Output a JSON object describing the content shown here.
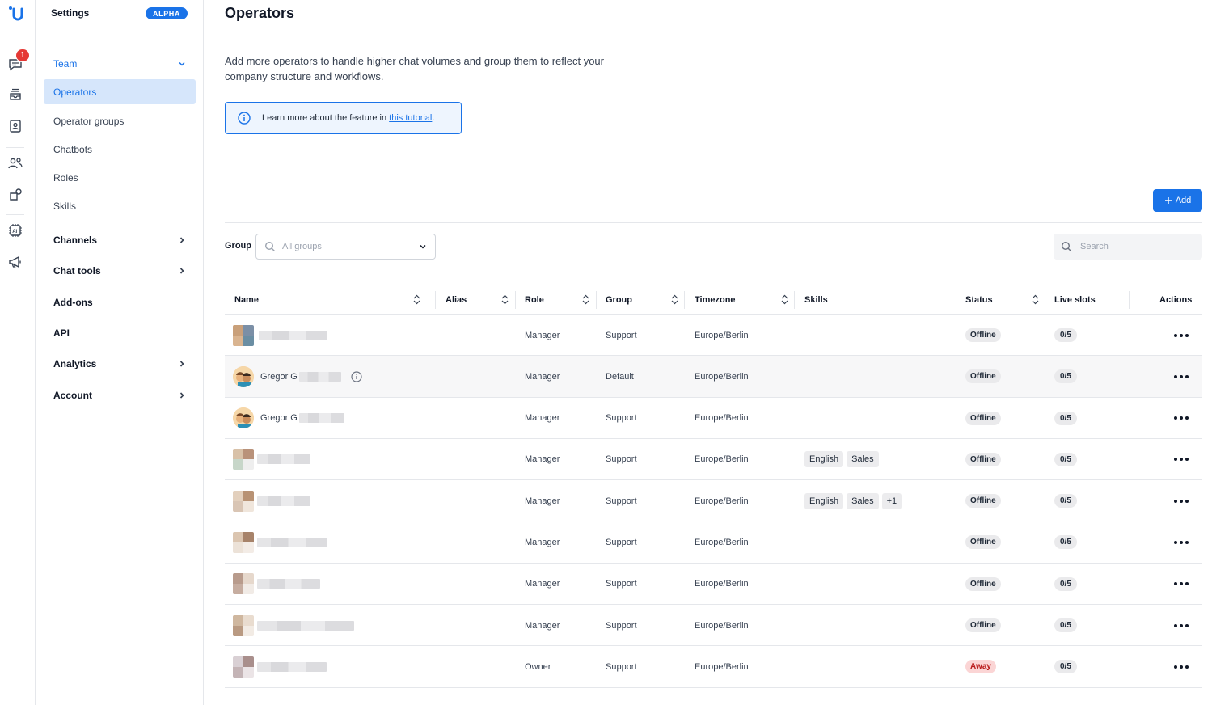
{
  "rail": {
    "chat_badge": "1",
    "icons": [
      "logo-icon",
      "chat-icon",
      "inbox-icon",
      "contacts-icon",
      "team-icon",
      "integrations-icon",
      "ai-icon",
      "campaigns-icon"
    ]
  },
  "sidebar": {
    "title": "Settings",
    "badge": "ALPHA",
    "team": "Team",
    "team_items": [
      "Operators",
      "Operator groups",
      "Chatbots",
      "Roles",
      "Skills"
    ],
    "sections": [
      "Channels",
      "Chat tools",
      "Add-ons",
      "API",
      "Analytics",
      "Account"
    ]
  },
  "main": {
    "title": "Operators",
    "description": "Add more operators to handle higher chat volumes and group them to reflect your company structure and workflows.",
    "info_text": "Learn more about the feature in ",
    "info_link": "this tutorial",
    "info_after": ".",
    "add_button": "Add",
    "group_label": "Group",
    "group_placeholder": "All groups",
    "search_placeholder": "Search"
  },
  "table": {
    "columns": [
      "Name",
      "Alias",
      "Role",
      "Group",
      "Timezone",
      "Skills",
      "Status",
      "Live slots",
      "Actions"
    ],
    "rows": [
      {
        "name": "",
        "role": "Manager",
        "group": "Support",
        "timezone": "Europe/Berlin",
        "skills": [],
        "status": "Offline",
        "slots": "0/5"
      },
      {
        "name": "Gregor G",
        "role": "Manager",
        "group": "Default",
        "timezone": "Europe/Berlin",
        "skills": [],
        "status": "Offline",
        "slots": "0/5"
      },
      {
        "name": "Gregor G",
        "role": "Manager",
        "group": "Support",
        "timezone": "Europe/Berlin",
        "skills": [],
        "status": "Offline",
        "slots": "0/5"
      },
      {
        "name": "",
        "role": "Manager",
        "group": "Support",
        "timezone": "Europe/Berlin",
        "skills": [
          "English",
          "Sales"
        ],
        "status": "Offline",
        "slots": "0/5"
      },
      {
        "name": "",
        "role": "Manager",
        "group": "Support",
        "timezone": "Europe/Berlin",
        "skills": [
          "English",
          "Sales",
          "+1"
        ],
        "status": "Offline",
        "slots": "0/5"
      },
      {
        "name": "",
        "role": "Manager",
        "group": "Support",
        "timezone": "Europe/Berlin",
        "skills": [],
        "status": "Offline",
        "slots": "0/5"
      },
      {
        "name": "",
        "role": "Manager",
        "group": "Support",
        "timezone": "Europe/Berlin",
        "skills": [],
        "status": "Offline",
        "slots": "0/5"
      },
      {
        "name": "",
        "role": "Manager",
        "group": "Support",
        "timezone": "Europe/Berlin",
        "skills": [],
        "status": "Offline",
        "slots": "0/5"
      },
      {
        "name": "",
        "role": "Owner",
        "group": "Support",
        "timezone": "Europe/Berlin",
        "skills": [],
        "status": "Away",
        "slots": "0/5"
      }
    ]
  },
  "colors": {
    "accent": "#1a73e8",
    "away": "#b91c1c",
    "badge": "#e53935"
  }
}
